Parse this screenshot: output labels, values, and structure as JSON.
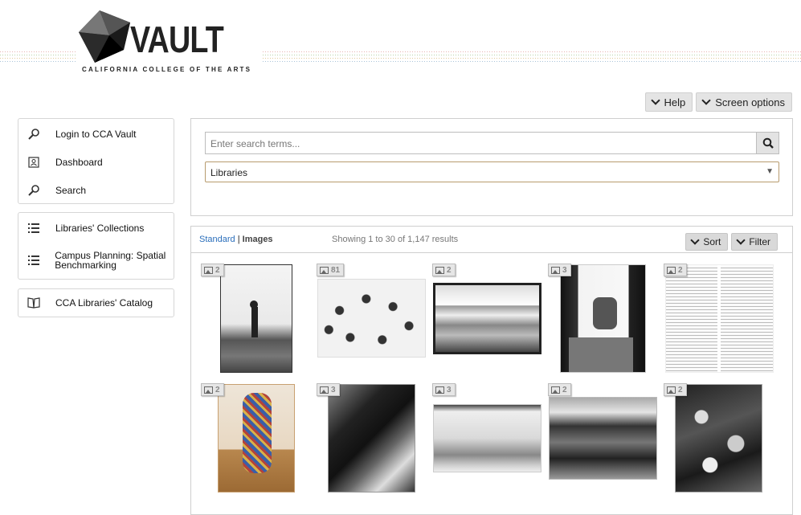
{
  "brand": {
    "name": "VAULT",
    "subtitle": "CALIFORNIA COLLEGE OF THE ARTS"
  },
  "top_buttons": [
    {
      "label": "Help"
    },
    {
      "label": "Screen options"
    }
  ],
  "sidebar": {
    "group1": [
      {
        "label": "Login to CCA Vault",
        "icon": "search-icon"
      },
      {
        "label": "Dashboard",
        "icon": "dashboard-icon"
      },
      {
        "label": "Search",
        "icon": "search-icon"
      }
    ],
    "group2": [
      {
        "label": "Libraries' Collections",
        "icon": "list-icon"
      },
      {
        "label": "Campus Planning: Spatial Benchmarking",
        "icon": "list-icon"
      }
    ],
    "group3": [
      {
        "label": "CCA Libraries' Catalog",
        "icon": "book-icon"
      }
    ]
  },
  "search": {
    "placeholder": "Enter search terms...",
    "collection": "Libraries"
  },
  "results": {
    "view_standard": "Standard",
    "separator": "|",
    "view_images": "Images",
    "count_text": "Showing 1 to 30 of 1,147 results",
    "sort_label": "Sort",
    "filter_label": "Filter",
    "items": [
      {
        "count": "2"
      },
      {
        "count": "81"
      },
      {
        "count": "2"
      },
      {
        "count": "3"
      },
      {
        "count": "2"
      },
      {
        "count": "2"
      },
      {
        "count": "3"
      },
      {
        "count": "3"
      },
      {
        "count": "2"
      },
      {
        "count": "2"
      }
    ]
  }
}
